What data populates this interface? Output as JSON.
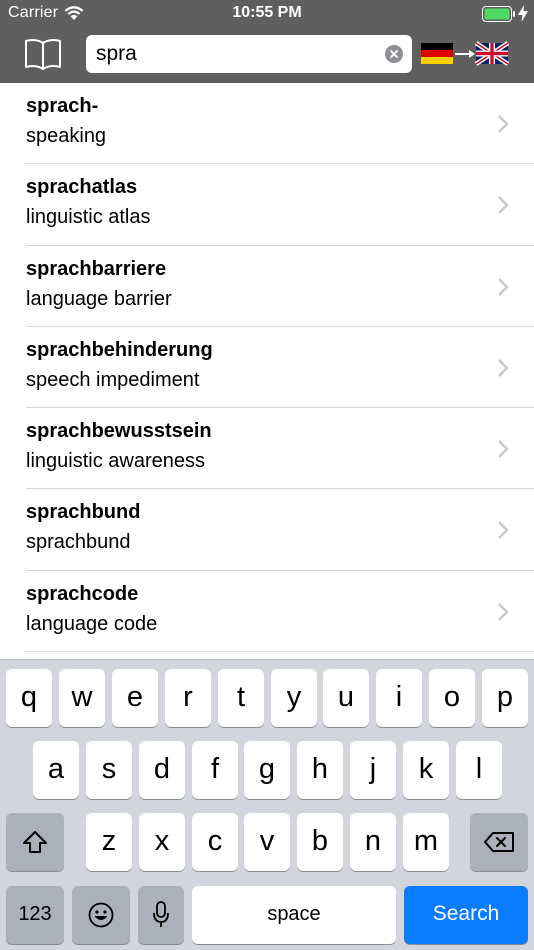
{
  "status_bar": {
    "carrier": "Carrier",
    "time": "10:55 PM",
    "battery_color": "#4cd964"
  },
  "nav": {
    "search_value": "spra",
    "source_language": "de",
    "target_language": "en",
    "background_color": "#5f5f5f"
  },
  "results": [
    {
      "word": "sprach-",
      "translation": "speaking"
    },
    {
      "word": "sprachatlas",
      "translation": "linguistic atlas"
    },
    {
      "word": "sprachbarriere",
      "translation": "language barrier"
    },
    {
      "word": "sprachbehinderung",
      "translation": "speech impediment"
    },
    {
      "word": "sprachbewusstsein",
      "translation": "linguistic awareness"
    },
    {
      "word": "sprachbund",
      "translation": "sprachbund"
    },
    {
      "word": "sprachcode",
      "translation": "language code"
    }
  ],
  "keyboard": {
    "row1": [
      "q",
      "w",
      "e",
      "r",
      "t",
      "y",
      "u",
      "i",
      "o",
      "p"
    ],
    "row2": [
      "a",
      "s",
      "d",
      "f",
      "g",
      "h",
      "j",
      "k",
      "l"
    ],
    "row3": [
      "z",
      "x",
      "c",
      "v",
      "b",
      "n",
      "m"
    ],
    "numbers_label": "123",
    "space_label": "space",
    "search_label": "Search",
    "search_key_color": "#0a7cff"
  }
}
